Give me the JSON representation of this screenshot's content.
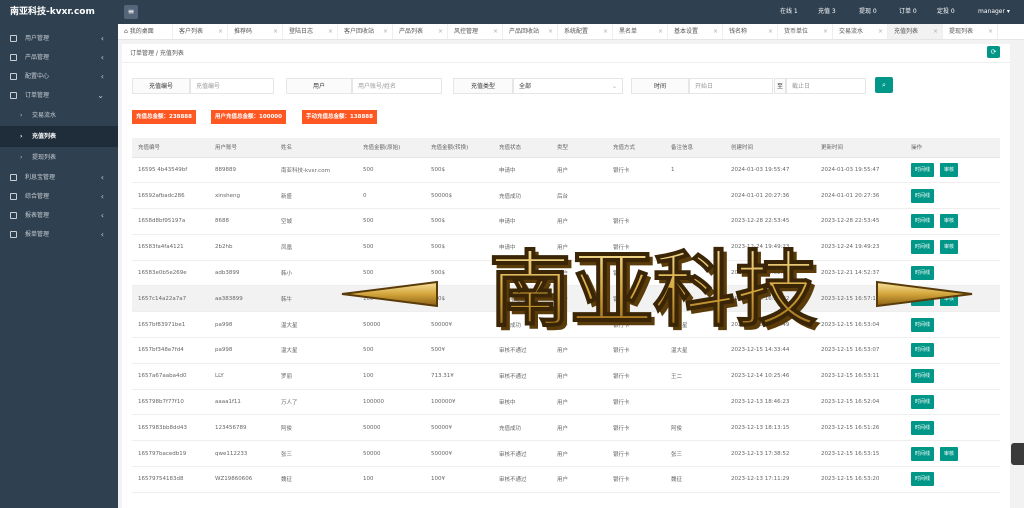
{
  "brand": "南亚科技-kvxr.com",
  "sidebar": {
    "items": [
      {
        "label": "用户管理",
        "chev": "‹"
      },
      {
        "label": "产品管理",
        "chev": "‹"
      },
      {
        "label": "配置中心",
        "chev": "‹"
      },
      {
        "label": "订单管理",
        "chev": "⌄"
      }
    ],
    "sub": [
      {
        "label": "交易流水"
      },
      {
        "label": "充值列表"
      },
      {
        "label": "提现列表"
      }
    ],
    "items2": [
      {
        "label": "利息宝管理"
      },
      {
        "label": "综合管理"
      },
      {
        "label": "报表管理"
      },
      {
        "label": "报单管理"
      }
    ]
  },
  "topbar": {
    "menu_icon": "≡",
    "stats": [
      "在线 1",
      "充值 3",
      "提现 0",
      "订单 0",
      "定投 0"
    ],
    "user": "manager ▾"
  },
  "tabs": [
    {
      "label": "我的桌面"
    },
    {
      "label": "客户列表"
    },
    {
      "label": "推荐码"
    },
    {
      "label": "登陆日志"
    },
    {
      "label": "客户回收站"
    },
    {
      "label": "产品列表"
    },
    {
      "label": "风控管理"
    },
    {
      "label": "产品回收站"
    },
    {
      "label": "系统配置"
    },
    {
      "label": "黑名单"
    },
    {
      "label": "基本设置"
    },
    {
      "label": "钱名称"
    },
    {
      "label": "货币单位"
    },
    {
      "label": "交易流水"
    },
    {
      "label": "充值列表"
    },
    {
      "label": "提现列表"
    }
  ],
  "breadcrumb": "订单管理  /  充值列表",
  "filters": {
    "order_label": "充值编号",
    "order_ph": "充值编号",
    "user_label": "用户",
    "user_ph": "用户账号/姓名",
    "type_label": "充值类型",
    "type_value": "全部",
    "time_label": "时间",
    "start_ph": "开始日",
    "to": "至",
    "end_ph": "截止日"
  },
  "summary": [
    "充值总金额：238888",
    "用户充值总金额：100000",
    "手动充值总金额：138888"
  ],
  "table": {
    "headers": [
      "充值编号",
      "用户账号",
      "姓名",
      "充值金额(原始)",
      "充值金额(转换)",
      "充值状态",
      "类型",
      "充值方式",
      "备注信息",
      "创建时间",
      "更新时间",
      "操作"
    ],
    "rows": [
      [
        "16595 4b43549bf",
        "889889",
        "南亚科技-kvxr.com",
        "500",
        "500$",
        "申请中",
        "用户",
        "银行卡",
        "1",
        "2024-01-03 19:55:47",
        "2024-01-03 19:55:47",
        "two"
      ],
      [
        "16592afbadc286",
        "xinsheng",
        "新盛",
        "0",
        "50000$",
        "充值成功",
        "后台",
        "",
        "",
        "2024-01-01 20:27:36",
        "2024-01-01 20:27:36",
        "one"
      ],
      [
        "1658d8bf95197a",
        "8688",
        "空城",
        "500",
        "500$",
        "申请中",
        "用户",
        "银行卡",
        "",
        "2023-12-28 22:53:45",
        "2023-12-28 22:53:45",
        "two"
      ],
      [
        "16583fa4fa4121",
        "2b2hb",
        "凤凰",
        "500",
        "500$",
        "申请中",
        "用户",
        "银行卡",
        "",
        "2023-12-24 19:49:23",
        "2023-12-24 19:49:23",
        "two"
      ],
      [
        "16583e0b5e269e",
        "adb3899",
        "韩小",
        "500",
        "500$",
        "审核不通过",
        "用户",
        "银行卡",
        "",
        "2023-12-21 14:52:37",
        "2023-12-21 14:52:37",
        "one"
      ],
      [
        "1657c14a22a7a7",
        "aa383899",
        "韩牛",
        "100",
        "100$",
        "审核不通过",
        "用户",
        "银行卡",
        "asda",
        "2023-12-15 16:56:02",
        "2023-12-15 16:57:17",
        "two"
      ],
      [
        "1657bf83971be1",
        "pa998",
        "温大星",
        "50000",
        "50000¥",
        "充值成功",
        "用户",
        "银行卡",
        "温大星",
        "2023-12-15 14:54:49",
        "2023-12-15 16:53:04",
        "one"
      ],
      [
        "1657bf348e7fd4",
        "pa998",
        "温大星",
        "500",
        "500¥",
        "审核不通过",
        "用户",
        "银行卡",
        "温大星",
        "2023-12-15 14:33:44",
        "2023-12-15 16:53:07",
        "one"
      ],
      [
        "1657a67aaba4d0",
        "LLY",
        "罗丽",
        "100",
        "713.31¥",
        "审核不通过",
        "用户",
        "银行卡",
        "王二",
        "2023-12-14 10:25:46",
        "2023-12-15 16:53:11",
        "one"
      ],
      [
        "165798b7f77f10",
        "aaaa1f11",
        "万人了",
        "100000",
        "100000¥",
        "审核中",
        "用户",
        "银行卡",
        "",
        "2023-12-13 18:46:23",
        "2023-12-15 16:52:04",
        "one"
      ],
      [
        "1657983bb8dd43",
        "123456789",
        "阿俊",
        "50000",
        "50000¥",
        "充值成功",
        "用户",
        "银行卡",
        "阿俊",
        "2023-12-13 18:13:15",
        "2023-12-15 16:51:26",
        "one"
      ],
      [
        "165797bacedb19",
        "qwe112233",
        "张三",
        "50000",
        "50000¥",
        "审核不通过",
        "用户",
        "银行卡",
        "张三",
        "2023-12-13 17:38:52",
        "2023-12-15 16:53:15",
        "two"
      ],
      [
        "16579754183d8",
        "WZ19860606",
        "魏征",
        "100",
        "100¥",
        "审核不通过",
        "用户",
        "银行卡",
        "魏征",
        "2023-12-13 17:11:29",
        "2023-12-15 16:53:20",
        "one"
      ]
    ],
    "btn_time": "时间线",
    "btn_review": "审核"
  },
  "watermark": "南亚科技",
  "colors": {
    "sidebar": "#2f4050",
    "accent": "#009688",
    "badge": "#ff5722",
    "success": "#5fb878"
  }
}
